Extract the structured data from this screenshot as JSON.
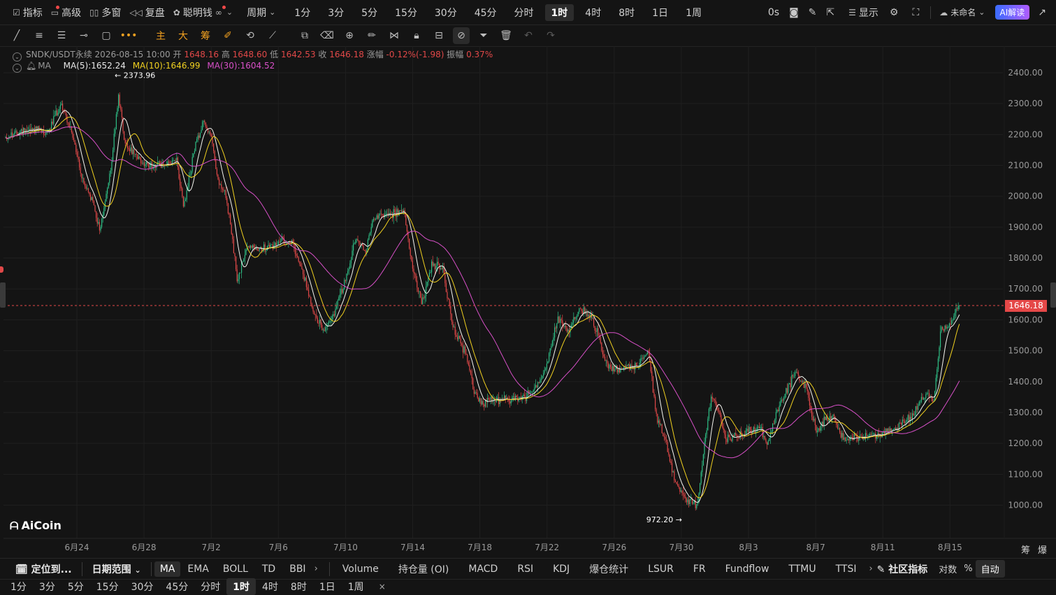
{
  "topbar": {
    "items": [
      {
        "icon": "indicator-icon",
        "label": "指标",
        "dot": true
      },
      {
        "icon": "advanced-icon",
        "label": "高级",
        "dot": false
      },
      {
        "icon": "multi-window-icon",
        "label": "多窗",
        "dot": false
      },
      {
        "icon": "replay-icon",
        "label": "复盘",
        "dot": false
      },
      {
        "icon": "smart-money-icon",
        "label": "聪明钱",
        "dot": true
      }
    ],
    "glasses_icon": "∞",
    "period_label": "周期",
    "periods": [
      "1分",
      "3分",
      "5分",
      "15分",
      "30分",
      "45分",
      "分时",
      "1时",
      "4时",
      "8时",
      "1日",
      "1周"
    ],
    "active_period": "1时",
    "countdown": "0s",
    "display_label": "显示",
    "layout_name": "未命名",
    "ai_label": "AI解读"
  },
  "info": {
    "symbol": "SNDK/USDT永续",
    "datetime": "2026-08-15 10:00",
    "open_label": "开",
    "open": "1648.16",
    "high_label": "高",
    "high": "1648.60",
    "low_label": "低",
    "low": "1642.53",
    "close_label": "收",
    "close": "1646.18",
    "change_label": "涨幅",
    "change": "-0.12%(-1.98)",
    "amp_label": "振幅",
    "amp": "0.37%",
    "ma_name": "MA",
    "ma5": "MA(5):1652.24",
    "ma10": "MA(10):1646.99",
    "ma30": "MA(30):1604.52"
  },
  "colors": {
    "up": "#2ebd85",
    "down": "#e04848",
    "ma5": "#f5f5f0",
    "ma10": "#f0d020",
    "ma30": "#d850c8",
    "price_line": "#e54848"
  },
  "price_tag": "1646.18",
  "logo": "AiCoin",
  "chou_label": "筹",
  "bao_label": "爆",
  "chart_data": {
    "type": "candlestick",
    "y_ticks": [
      "2400.00",
      "2300.00",
      "2200.00",
      "2100.00",
      "2000.00",
      "1900.00",
      "1800.00",
      "1700.00",
      "1600.00",
      "1500.00",
      "1400.00",
      "1300.00",
      "1200.00",
      "1100.00",
      "1000.00"
    ],
    "ylim": [
      950,
      2470
    ],
    "x_ticks": [
      "6月24",
      "6月28",
      "7月2",
      "7月6",
      "7月10",
      "7月14",
      "7月18",
      "7月22",
      "7月26",
      "7月30",
      "8月3",
      "8月7",
      "8月11",
      "8月15"
    ],
    "current_price": 1646.18,
    "max_label": "← 2373.96",
    "min_label": "972.20 →",
    "high_value": 2373.96,
    "low_value": 972.2,
    "series_trend": [
      [
        0,
        2190
      ],
      [
        30,
        2220
      ],
      [
        60,
        2210
      ],
      [
        80,
        2300
      ],
      [
        95,
        2200
      ],
      [
        110,
        2050
      ],
      [
        125,
        1980
      ],
      [
        135,
        1890
      ],
      [
        150,
        2080
      ],
      [
        162,
        2330
      ],
      [
        170,
        2180
      ],
      [
        185,
        2130
      ],
      [
        200,
        2100
      ],
      [
        230,
        2105
      ],
      [
        245,
        2110
      ],
      [
        255,
        1960
      ],
      [
        270,
        2150
      ],
      [
        283,
        2250
      ],
      [
        295,
        2180
      ],
      [
        305,
        2040
      ],
      [
        315,
        2000
      ],
      [
        322,
        1900
      ],
      [
        332,
        1720
      ],
      [
        345,
        1840
      ],
      [
        370,
        1830
      ],
      [
        395,
        1855
      ],
      [
        410,
        1850
      ],
      [
        425,
        1760
      ],
      [
        440,
        1630
      ],
      [
        455,
        1560
      ],
      [
        470,
        1620
      ],
      [
        485,
        1720
      ],
      [
        500,
        1860
      ],
      [
        515,
        1820
      ],
      [
        525,
        1920
      ],
      [
        545,
        1940
      ],
      [
        570,
        1950
      ],
      [
        580,
        1800
      ],
      [
        595,
        1650
      ],
      [
        610,
        1780
      ],
      [
        625,
        1770
      ],
      [
        640,
        1580
      ],
      [
        660,
        1480
      ],
      [
        670,
        1370
      ],
      [
        680,
        1330
      ],
      [
        695,
        1340
      ],
      [
        720,
        1345
      ],
      [
        745,
        1350
      ],
      [
        760,
        1390
      ],
      [
        775,
        1460
      ],
      [
        790,
        1600
      ],
      [
        805,
        1560
      ],
      [
        820,
        1630
      ],
      [
        835,
        1620
      ],
      [
        845,
        1570
      ],
      [
        860,
        1450
      ],
      [
        880,
        1440
      ],
      [
        900,
        1450
      ],
      [
        920,
        1500
      ],
      [
        930,
        1300
      ],
      [
        945,
        1200
      ],
      [
        960,
        1060
      ],
      [
        975,
        1020
      ],
      [
        990,
        1000
      ],
      [
        1000,
        1200
      ],
      [
        1010,
        1360
      ],
      [
        1020,
        1310
      ],
      [
        1030,
        1210
      ],
      [
        1045,
        1230
      ],
      [
        1060,
        1240
      ],
      [
        1080,
        1250
      ],
      [
        1090,
        1200
      ],
      [
        1100,
        1280
      ],
      [
        1115,
        1360
      ],
      [
        1130,
        1430
      ],
      [
        1145,
        1380
      ],
      [
        1160,
        1230
      ],
      [
        1170,
        1270
      ],
      [
        1185,
        1290
      ],
      [
        1195,
        1220
      ],
      [
        1215,
        1220
      ],
      [
        1240,
        1225
      ],
      [
        1260,
        1240
      ],
      [
        1280,
        1260
      ],
      [
        1300,
        1300
      ],
      [
        1315,
        1360
      ],
      [
        1328,
        1340
      ],
      [
        1338,
        1560
      ],
      [
        1350,
        1590
      ],
      [
        1366,
        1646
      ]
    ]
  },
  "bottombar": {
    "locate": "定位到...",
    "date_range": "日期范围",
    "main_indicators": [
      "MA",
      "EMA",
      "BOLL",
      "TD",
      "BBI"
    ],
    "active_main": "MA",
    "sub_indicators": [
      "Volume",
      "持仓量 (OI)",
      "MACD",
      "RSI",
      "KDJ",
      "爆仓统计",
      "LSUR",
      "FR",
      "Fundflow",
      "TTMU",
      "TTSI"
    ],
    "community": "社区指标",
    "log_label": "对数",
    "percent_label": "%",
    "auto_label": "自动"
  },
  "periodbar": {
    "periods": [
      "1分",
      "3分",
      "5分",
      "15分",
      "30分",
      "45分",
      "分时",
      "1时",
      "4时",
      "8时",
      "1日",
      "1周"
    ],
    "active": "1时",
    "close": "×"
  }
}
